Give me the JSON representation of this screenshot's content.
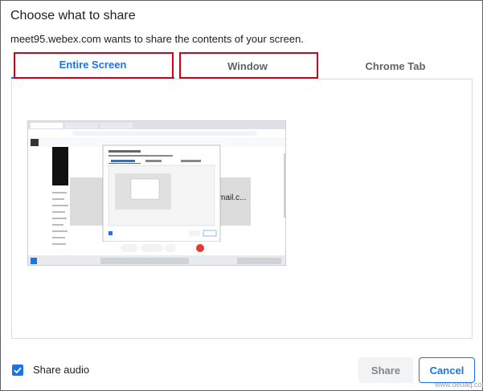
{
  "dialog": {
    "title": "Choose what to share",
    "subtitle": "meet95.webex.com wants to share the contents of your screen."
  },
  "tabs": [
    {
      "label": "Entire Screen",
      "selected": true
    },
    {
      "label": "Window",
      "selected": false
    },
    {
      "label": "Chrome Tab",
      "selected": false
    }
  ],
  "thumbnail": {
    "partial_text": "mail.c...",
    "inner_tabs": [
      "Entire Screen",
      "Window",
      "Chrome Tab"
    ]
  },
  "footer": {
    "share_audio_label": "Share audio",
    "share_audio_checked": true,
    "share_button": "Share",
    "cancel_button": "Cancel"
  },
  "watermark": "www.deuaq.com",
  "colors": {
    "accent": "#1a73e8",
    "highlight_border": "#d0021b",
    "disabled_bg": "#f1f3f4"
  }
}
